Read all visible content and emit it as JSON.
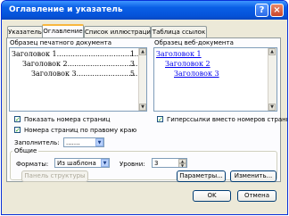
{
  "window": {
    "title": "Оглавление и указатель",
    "help_icon": "?",
    "close_icon": "×"
  },
  "tabs": [
    {
      "label": "Указатель",
      "active": false
    },
    {
      "label": "Оглавление",
      "active": true
    },
    {
      "label": "Список иллюстраций",
      "active": false
    },
    {
      "label": "Таблица ссылок",
      "active": false
    }
  ],
  "print_preview": {
    "label": "Образец печатного документа",
    "entries": [
      {
        "text": "Заголовок 1......................................",
        "page": "1"
      },
      {
        "text": "Заголовок 2...................................",
        "page": "3"
      },
      {
        "text": "Заголовок 3................................",
        "page": "5"
      }
    ]
  },
  "web_preview": {
    "label": "Образец веб-документа",
    "entries": [
      "Заголовок 1",
      "Заголовок 2",
      "Заголовок 3"
    ]
  },
  "options": {
    "show_page_numbers": "Показать номера страниц",
    "align_right": "Номера страниц по правому краю",
    "hyperlinks": "Гиперссылки вместо номеров страниц",
    "leader_label": "Заполнитель:",
    "leader_value": "......."
  },
  "general": {
    "title": "Общие",
    "formats_label": "Форматы:",
    "formats_value": "Из шаблона",
    "levels_label": "Уровни:",
    "levels_value": "3"
  },
  "buttons": {
    "outline_toolbar": "Панель структуры",
    "parameters": "Параметры...",
    "modify": "Изменить...",
    "ok": "OK",
    "cancel": "Отмена"
  }
}
